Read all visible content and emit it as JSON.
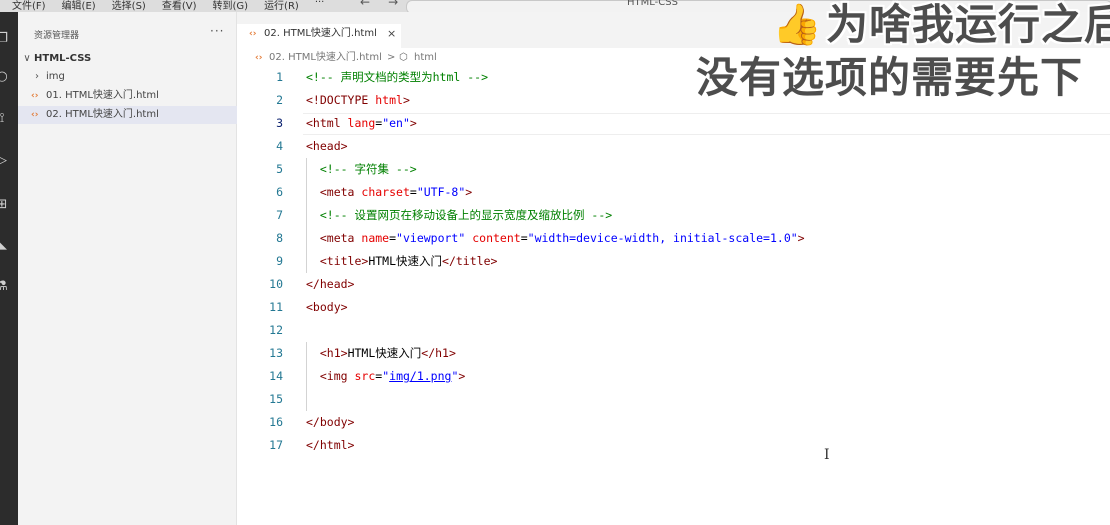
{
  "menubar": {
    "menus": [
      "文件(F)",
      "编辑(E)",
      "选择(S)",
      "查看(V)",
      "转到(G)",
      "运行(R)",
      "···"
    ],
    "back": "←",
    "forward": "→",
    "search_text": "HTML-CSS"
  },
  "sidebar": {
    "title": "资源管理器",
    "more": "···",
    "folder": "HTML-CSS",
    "items": [
      {
        "label": "img",
        "kind": "folder"
      },
      {
        "label": "01. HTML快速入门.html",
        "kind": "html"
      },
      {
        "label": "02. HTML快速入门.html",
        "kind": "html"
      }
    ]
  },
  "tab": {
    "label": "02. HTML快速入门.html",
    "close": "×"
  },
  "breadcrumb": {
    "file": "02. HTML快速入门.html",
    "separator": ">",
    "symbol": "html"
  },
  "editor": {
    "active_line": 3,
    "lines": [
      {
        "n": "1",
        "tokens": [
          [
            "c",
            "<!-- 声明文档的类型为html -->"
          ]
        ]
      },
      {
        "n": "2",
        "tokens": [
          [
            "p",
            "<!DOCTYPE "
          ],
          [
            "a",
            "html"
          ],
          [
            "p",
            ">"
          ]
        ]
      },
      {
        "n": "3",
        "tokens": [
          [
            "t",
            "<html "
          ],
          [
            "a",
            "lang"
          ],
          [
            "x",
            "="
          ],
          [
            "v",
            "\"en\""
          ],
          [
            "t",
            ">"
          ]
        ]
      },
      {
        "n": "4",
        "tokens": [
          [
            "t",
            "<head>"
          ]
        ]
      },
      {
        "n": "5",
        "tokens": [
          [
            "x",
            "  "
          ],
          [
            "c",
            "<!-- 字符集 -->"
          ]
        ]
      },
      {
        "n": "6",
        "tokens": [
          [
            "x",
            "  "
          ],
          [
            "t",
            "<meta "
          ],
          [
            "a",
            "charset"
          ],
          [
            "x",
            "="
          ],
          [
            "v",
            "\"UTF-8\""
          ],
          [
            "t",
            ">"
          ]
        ]
      },
      {
        "n": "7",
        "tokens": [
          [
            "x",
            "  "
          ],
          [
            "c",
            "<!-- 设置网页在移动设备上的显示宽度及缩放比例 -->"
          ]
        ]
      },
      {
        "n": "8",
        "tokens": [
          [
            "x",
            "  "
          ],
          [
            "t",
            "<meta "
          ],
          [
            "a",
            "name"
          ],
          [
            "x",
            "="
          ],
          [
            "v",
            "\"viewport\""
          ],
          [
            "x",
            " "
          ],
          [
            "a",
            "content"
          ],
          [
            "x",
            "="
          ],
          [
            "v",
            "\"width=device-width, initial-scale=1.0\""
          ],
          [
            "t",
            ">"
          ]
        ]
      },
      {
        "n": "9",
        "tokens": [
          [
            "x",
            "  "
          ],
          [
            "t",
            "<title>"
          ],
          [
            "x",
            "HTML快速入门"
          ],
          [
            "t",
            "</title>"
          ]
        ]
      },
      {
        "n": "10",
        "tokens": [
          [
            "t",
            "</head>"
          ]
        ]
      },
      {
        "n": "11",
        "tokens": [
          [
            "t",
            "<body>"
          ]
        ]
      },
      {
        "n": "12",
        "tokens": []
      },
      {
        "n": "13",
        "tokens": [
          [
            "x",
            "  "
          ],
          [
            "t",
            "<h1>"
          ],
          [
            "x",
            "HTML快速入门"
          ],
          [
            "t",
            "</h1>"
          ]
        ]
      },
      {
        "n": "14",
        "tokens": [
          [
            "x",
            "  "
          ],
          [
            "t",
            "<img "
          ],
          [
            "a",
            "src"
          ],
          [
            "x",
            "="
          ],
          [
            "v",
            "\""
          ],
          [
            "l",
            "img/1.png"
          ],
          [
            "v",
            "\""
          ],
          [
            "t",
            ">"
          ]
        ]
      },
      {
        "n": "15",
        "tokens": []
      },
      {
        "n": "16",
        "tokens": [
          [
            "t",
            "</body>"
          ]
        ]
      },
      {
        "n": "17",
        "tokens": [
          [
            "t",
            "</html>"
          ]
        ]
      }
    ]
  },
  "overlay": {
    "line1": "为啥我运行之后",
    "line2": "没有选项的需要先下"
  },
  "colors": {
    "comment": "#008000",
    "tag": "#800000",
    "attribute": "#e50000",
    "value": "#0000ff",
    "line_number": "#237893",
    "html_icon": "#e37933"
  },
  "icons": [
    "explorer-icon",
    "search-icon",
    "source-control-icon",
    "run-debug-icon",
    "extensions-icon",
    "remote-icon",
    "test-icon",
    "html-file-icon",
    "cube-symbol-icon",
    "thumbs-up-icon"
  ]
}
